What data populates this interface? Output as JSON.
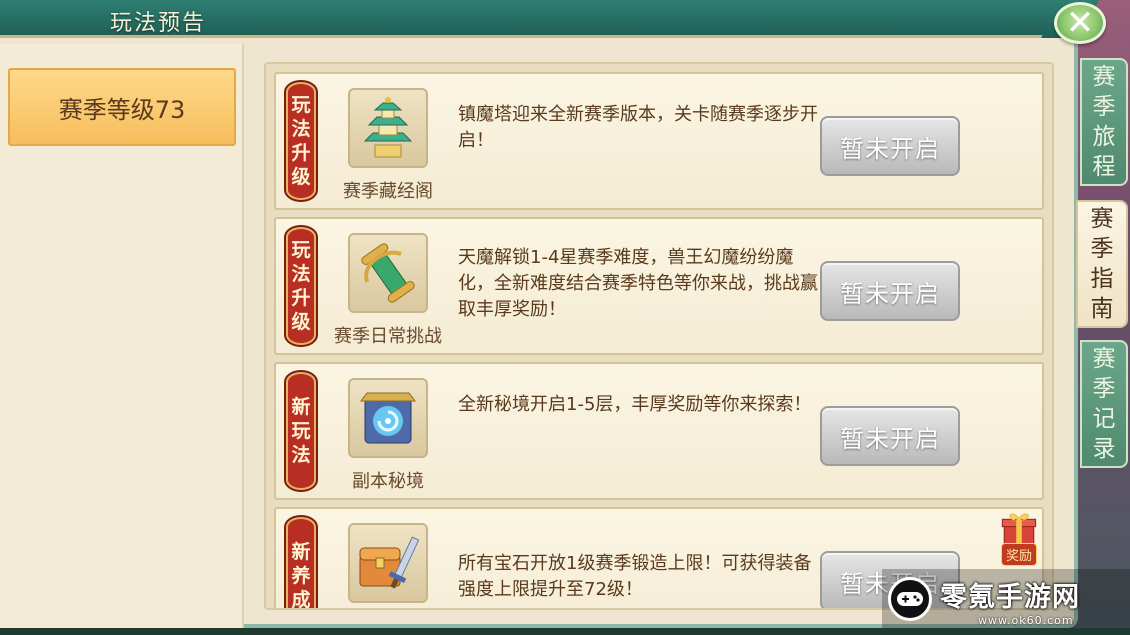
{
  "header": {
    "title": "玩法预告",
    "close_icon": "close-x-icon"
  },
  "sidebar": {
    "season_level": "赛季等级73"
  },
  "cards": [
    {
      "tag": [
        "玩",
        "法",
        "升",
        "级"
      ],
      "icon": "pagoda-icon",
      "name": "赛季藏经阁",
      "description": "镇魔塔迎来全新赛季版本，关卡随赛季逐步开启！",
      "status": "暂未开启"
    },
    {
      "tag": [
        "玩",
        "法",
        "升",
        "级"
      ],
      "icon": "scroll-icon",
      "name": "赛季日常挑战",
      "description": "天魔解锁1-4星赛季难度，兽王幻魔纷纷魔化，全新难度结合赛季特色等你来战，挑战赢取丰厚奖励！",
      "status": "暂未开启"
    },
    {
      "tag": [
        "新",
        "玩",
        "法"
      ],
      "icon": "portal-gate-icon",
      "name": "副本秘境",
      "description": "全新秘境开启1-5层，丰厚奖励等你来探索！",
      "status": "暂未开启"
    },
    {
      "tag": [
        "新",
        "养",
        "成"
      ],
      "icon": "treasure-chest-sword-icon",
      "name": "",
      "description": "所有宝石开放1级赛季锻造上限！可获得装备强度上限提升至72级！",
      "status": "暂未开启"
    }
  ],
  "side_tabs": [
    {
      "label": [
        "赛",
        "季",
        "旅",
        "程"
      ],
      "active": false
    },
    {
      "label": [
        "赛",
        "季",
        "指",
        "南"
      ],
      "active": true
    },
    {
      "label": [
        "赛",
        "季",
        "记",
        "录"
      ],
      "active": false
    }
  ],
  "reward": {
    "label": "奖励",
    "icon": "gift-box-icon"
  },
  "watermark": {
    "title": "零氪手游网",
    "sub": "www.ok60.com",
    "icon": "gamepad-pin-icon"
  }
}
